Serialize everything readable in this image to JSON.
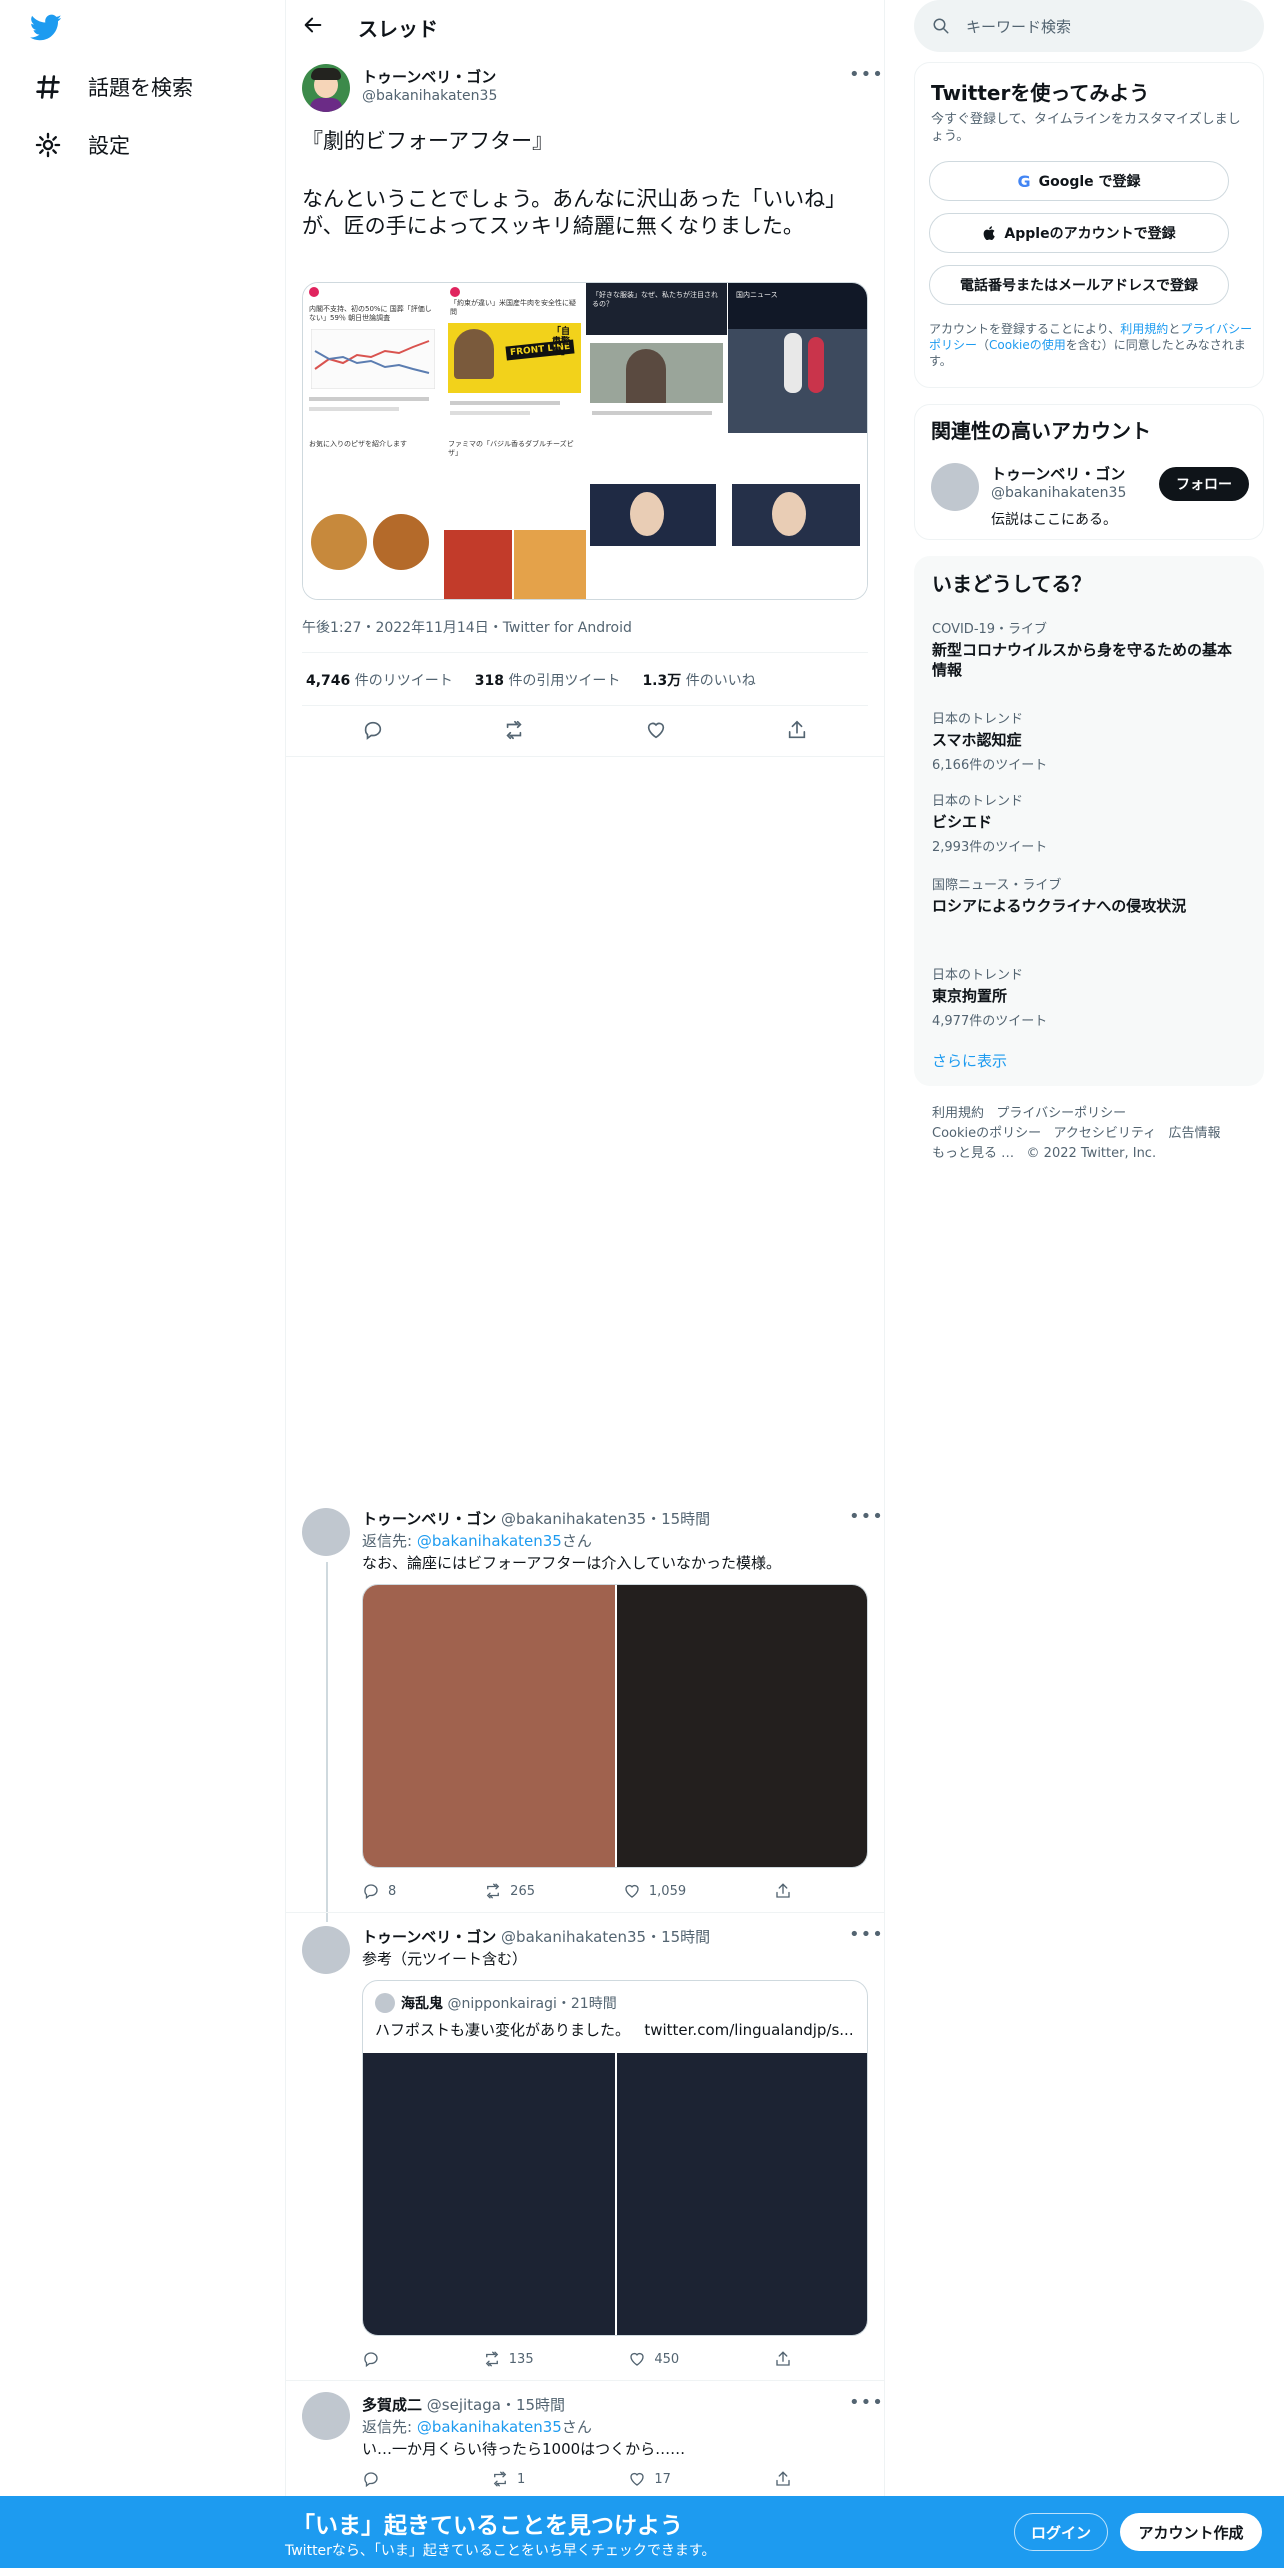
{
  "nav": {
    "explore_label": "話題を検索",
    "settings_label": "設定"
  },
  "header": {
    "title": "スレッド"
  },
  "tweet": {
    "display_name": "トゥーンベリ・ゴン",
    "handle": "@bakanihakaten35",
    "text_line1": "『劇的ビフォーアフター』",
    "text_line2": "なんということでしょう。あんなに沢山あった「いいね」が、匠の手によってスッキリ綺麗に無くなりました。",
    "meta": "午後1:27・2022年11月14日・Twitter for Android",
    "retweets_num": "4,746",
    "retweets_label": "件のリツイート",
    "quotes_num": "318",
    "quotes_label": "件の引用ツイート",
    "likes_num": "1.3万",
    "likes_label": "件のいいね"
  },
  "image_text": {
    "p1": "内閣不支持、初の50%に 国葬「評価しない」59％ 朝日世論調査",
    "p2": "「約束が違い」米国産牛肉を安全性に疑問",
    "p2_banner": "FRONT LINE",
    "p2_side": "「自粛警察」",
    "p3": "お気に入りのピザを紹介します",
    "p4": "ファミマの「バジル香るダブルチーズピザ」",
    "p5": "「好きな服装」なぜ、私たちが注目されるの？",
    "p6": "国内ニュース"
  },
  "replies": [
    {
      "display_name": "トゥーンベリ・ゴン",
      "handle": "@bakanihakaten35",
      "time": "・15時間",
      "reply_prefix": "返信先: ",
      "reply_to": "@bakanihakaten35",
      "reply_suffix": "さん",
      "text": "なお、論座にはビフォーアフターは介入していなかった模様。",
      "stats": {
        "reply": "8",
        "retweet": "265",
        "like": "1,059"
      }
    },
    {
      "display_name": "トゥーンベリ・ゴン",
      "handle": "@bakanihakaten35",
      "time": "・15時間",
      "text": "参考（元ツイート含む）",
      "quote": {
        "display_name": "海乱鬼",
        "handle": "@nipponkairagi",
        "time": "・21時間",
        "text": "ハフポストも凄い変化がありました。",
        "link": "twitter.com/lingualandjp/s..."
      },
      "stats": {
        "reply": "",
        "retweet": "135",
        "like": "450"
      }
    },
    {
      "display_name": "多賀成二",
      "handle": "@sejitaga",
      "time": "・15時間",
      "reply_prefix": "返信先: ",
      "reply_to": "@bakanihakaten35",
      "reply_suffix": "さん",
      "text": "い…一か月くらい待ったら1000はつくから……",
      "stats": {
        "reply": "",
        "retweet": "1",
        "like": "17"
      }
    }
  ],
  "sidebar": {
    "search_placeholder": "キーワード検索",
    "signup": {
      "title": "Twitterを使ってみよう",
      "subtitle": "今すぐ登録して、タイムラインをカスタマイズしましょう。",
      "google_label": "Google で登録",
      "apple_label": "Appleのアカウントで登録",
      "phone_label": "電話番号またはメールアドレスで登録",
      "terms_prefix": "アカウントを登録することにより、",
      "terms_link1": "利用規約",
      "terms_mid1": "と",
      "terms_link2": "プライバシーポリシー",
      "terms_mid2": "（",
      "terms_link3": "Cookieの使用",
      "terms_suffix": "を含む）に同意したとみなされます。"
    },
    "related": {
      "title": "関連性の高いアカウント",
      "name": "トゥーンベリ・ゴン",
      "handle": "@bakanihakaten35",
      "bio": "伝説はここにある。",
      "follow_label": "フォロー"
    },
    "trends": {
      "title": "いまどうしてる？",
      "items": [
        {
          "category": "COVID-19・ライブ",
          "name": "新型コロナウイルスから身を守るための基本情報",
          "count": ""
        },
        {
          "category": "日本のトレンド",
          "name": "スマホ認知症",
          "count": "6,166件のツイート"
        },
        {
          "category": "日本のトレンド",
          "name": "ビシエド",
          "count": "2,993件のツイート"
        },
        {
          "category": "国際ニュース・ライブ",
          "name": "ロシアによるウクライナへの侵攻状況",
          "count": ""
        },
        {
          "category": "日本のトレンド",
          "name": "東京拘置所",
          "count": "4,977件のツイート"
        }
      ],
      "show_more": "さらに表示"
    },
    "footer": {
      "terms": "利用規約",
      "privacy": "プライバシーポリシー",
      "cookie": "Cookieのポリシー",
      "accessibility": "アクセシビリティ",
      "ads": "広告情報",
      "more": "もっと見る …",
      "copyright": "© 2022 Twitter, Inc."
    }
  },
  "bottom_bar": {
    "title": "「いま」起きていることを見つけよう",
    "subtitle": "Twitterなら、「いま」起きていることをいち早くチェックできます。",
    "login_label": "ログイン",
    "signup_label": "アカウント作成"
  },
  "colors": {
    "accent": "#1d9bf0",
    "text": "#0f1419",
    "muted": "#536471"
  }
}
